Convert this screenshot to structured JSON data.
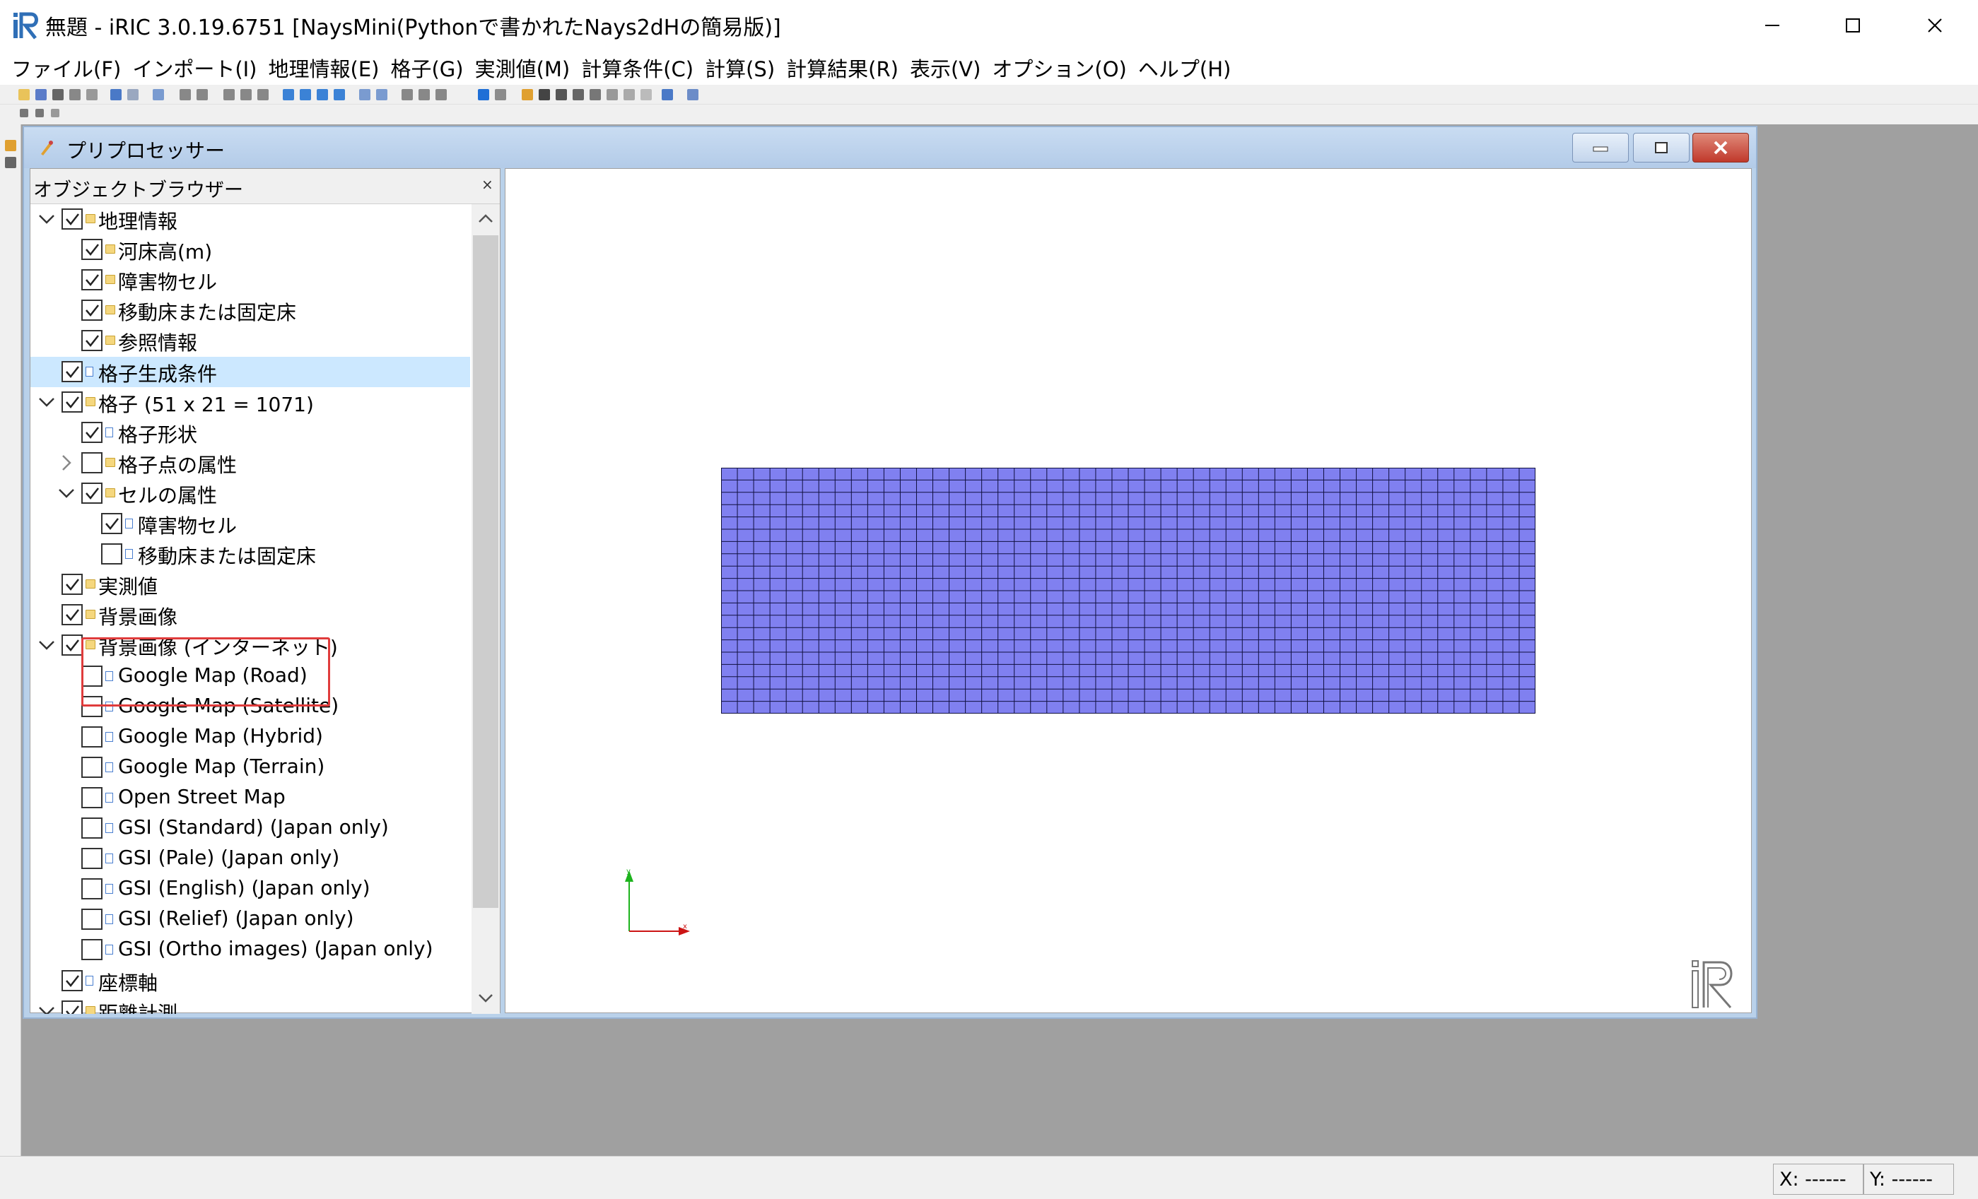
{
  "window": {
    "title": "無題 - iRIC 3.0.19.6751 [NaysMini(Pythonで書かれたNays2dHの簡易版)]"
  },
  "menu": [
    "ファイル(F)",
    "インポート(I)",
    "地理情報(E)",
    "格子(G)",
    "実測値(M)",
    "計算条件(C)",
    "計算(S)",
    "計算結果(R)",
    "表示(V)",
    "オプション(O)",
    "ヘルプ(H)"
  ],
  "preprocessor": {
    "title": "プリプロセッサー"
  },
  "object_browser": {
    "title": "オブジェクトブラウザー",
    "close": "×",
    "tree": [
      {
        "label": "地理情報",
        "level": 0,
        "expander": "expanded",
        "checked": true,
        "icon": "folder-icon"
      },
      {
        "label": "河床高(m)",
        "level": 1,
        "expander": "none",
        "checked": true,
        "icon": "folder-icon"
      },
      {
        "label": "障害物セル",
        "level": 1,
        "expander": "none",
        "checked": true,
        "icon": "folder-icon"
      },
      {
        "label": "移動床または固定床",
        "level": 1,
        "expander": "none",
        "checked": true,
        "icon": "folder-icon"
      },
      {
        "label": "参照情報",
        "level": 1,
        "expander": "none",
        "checked": true,
        "icon": "folder-icon"
      },
      {
        "label": "格子生成条件",
        "level": 0,
        "expander": "none",
        "checked": true,
        "icon": "item-icon",
        "selected": true
      },
      {
        "label": "格子 (51 x 21 = 1071)",
        "level": 0,
        "expander": "expanded",
        "checked": true,
        "icon": "folder-icon"
      },
      {
        "label": "格子形状",
        "level": 1,
        "expander": "none",
        "checked": true,
        "icon": "item-icon"
      },
      {
        "label": "格子点の属性",
        "level": 1,
        "expander": "collapsed",
        "checked": false,
        "icon": "folder-icon"
      },
      {
        "label": "セルの属性",
        "level": 1,
        "expander": "expanded",
        "checked": true,
        "icon": "folder-icon"
      },
      {
        "label": "障害物セル",
        "level": 2,
        "expander": "none",
        "checked": true,
        "icon": "item-icon"
      },
      {
        "label": "移動床または固定床",
        "level": 2,
        "expander": "none",
        "checked": false,
        "icon": "item-icon"
      },
      {
        "label": "実測値",
        "level": 0,
        "expander": "none",
        "checked": true,
        "icon": "folder-icon"
      },
      {
        "label": "背景画像",
        "level": 0,
        "expander": "none",
        "checked": true,
        "icon": "folder-icon"
      },
      {
        "label": "背景画像 (インターネット)",
        "level": 0,
        "expander": "expanded",
        "checked": true,
        "icon": "folder-icon"
      },
      {
        "label": "Google Map (Road)",
        "level": 1,
        "expander": "none",
        "checked": false,
        "icon": "item-icon"
      },
      {
        "label": "Google Map (Satellite)",
        "level": 1,
        "expander": "none",
        "checked": false,
        "icon": "item-icon"
      },
      {
        "label": "Google Map (Hybrid)",
        "level": 1,
        "expander": "none",
        "checked": false,
        "icon": "item-icon"
      },
      {
        "label": "Google Map (Terrain)",
        "level": 1,
        "expander": "none",
        "checked": false,
        "icon": "item-icon"
      },
      {
        "label": "Open Street Map",
        "level": 1,
        "expander": "none",
        "checked": false,
        "icon": "item-icon"
      },
      {
        "label": "GSI (Standard) (Japan only)",
        "level": 1,
        "expander": "none",
        "checked": false,
        "icon": "item-icon"
      },
      {
        "label": "GSI (Pale) (Japan only)",
        "level": 1,
        "expander": "none",
        "checked": false,
        "icon": "item-icon"
      },
      {
        "label": "GSI (English) (Japan only)",
        "level": 1,
        "expander": "none",
        "checked": false,
        "icon": "item-icon"
      },
      {
        "label": "GSI (Relief) (Japan only)",
        "level": 1,
        "expander": "none",
        "checked": false,
        "icon": "item-icon"
      },
      {
        "label": "GSI (Ortho images) (Japan only)",
        "level": 1,
        "expander": "none",
        "checked": false,
        "icon": "item-icon"
      },
      {
        "label": "座標軸",
        "level": 0,
        "expander": "none",
        "checked": true,
        "icon": "item-icon"
      },
      {
        "label": "距離計測",
        "level": 0,
        "expander": "expanded",
        "checked": true,
        "icon": "folder-icon"
      }
    ]
  },
  "canvas": {
    "grid_columns": 50,
    "grid_rows": 20,
    "grid_fill": "#8080f0",
    "grid_line": "#101040",
    "axis_y_color": "#1db31d",
    "axis_x_color": "#cc1414",
    "axis_y_label": "y",
    "axis_x_label": "x"
  },
  "status": {
    "x": "X: ------",
    "y": "Y: ------"
  },
  "colors": {
    "highlight": "#e03c3c",
    "selection": "#cce8ff"
  }
}
